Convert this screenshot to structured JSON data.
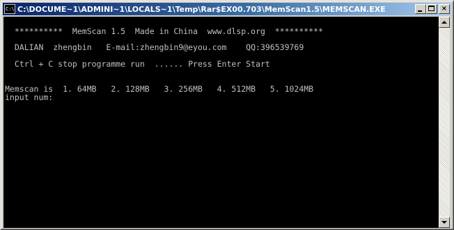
{
  "window": {
    "title": "C:\\DOCUME~1\\ADMINI~1\\LOCALS~1\\Temp\\Rar$EX00.703\\MemScan1.5\\MEMSCAN.EXE",
    "icon_label": "C:\\",
    "close_label": "×",
    "icons": [
      "console-app-icon",
      "minimize-icon",
      "maximize-icon",
      "close-icon",
      "scroll-up-icon",
      "scroll-down-icon"
    ]
  },
  "console": {
    "background_color": "#000000",
    "text_color": "#c0c0c0",
    "lines": [
      "  **********  MemScan 1.5  Made in China  www.dlsp.org  **********",
      "  DALIAN  zhengbin   E-mail:zhengbin9@eyou.com    QQ:396539769",
      "  Ctrl + C stop programme run  ...... Press Enter Start",
      "Memscan is  1. 64MB   2. 128MB   3. 256MB   4. 512MB   5. 1024MB",
      "input num:"
    ]
  }
}
